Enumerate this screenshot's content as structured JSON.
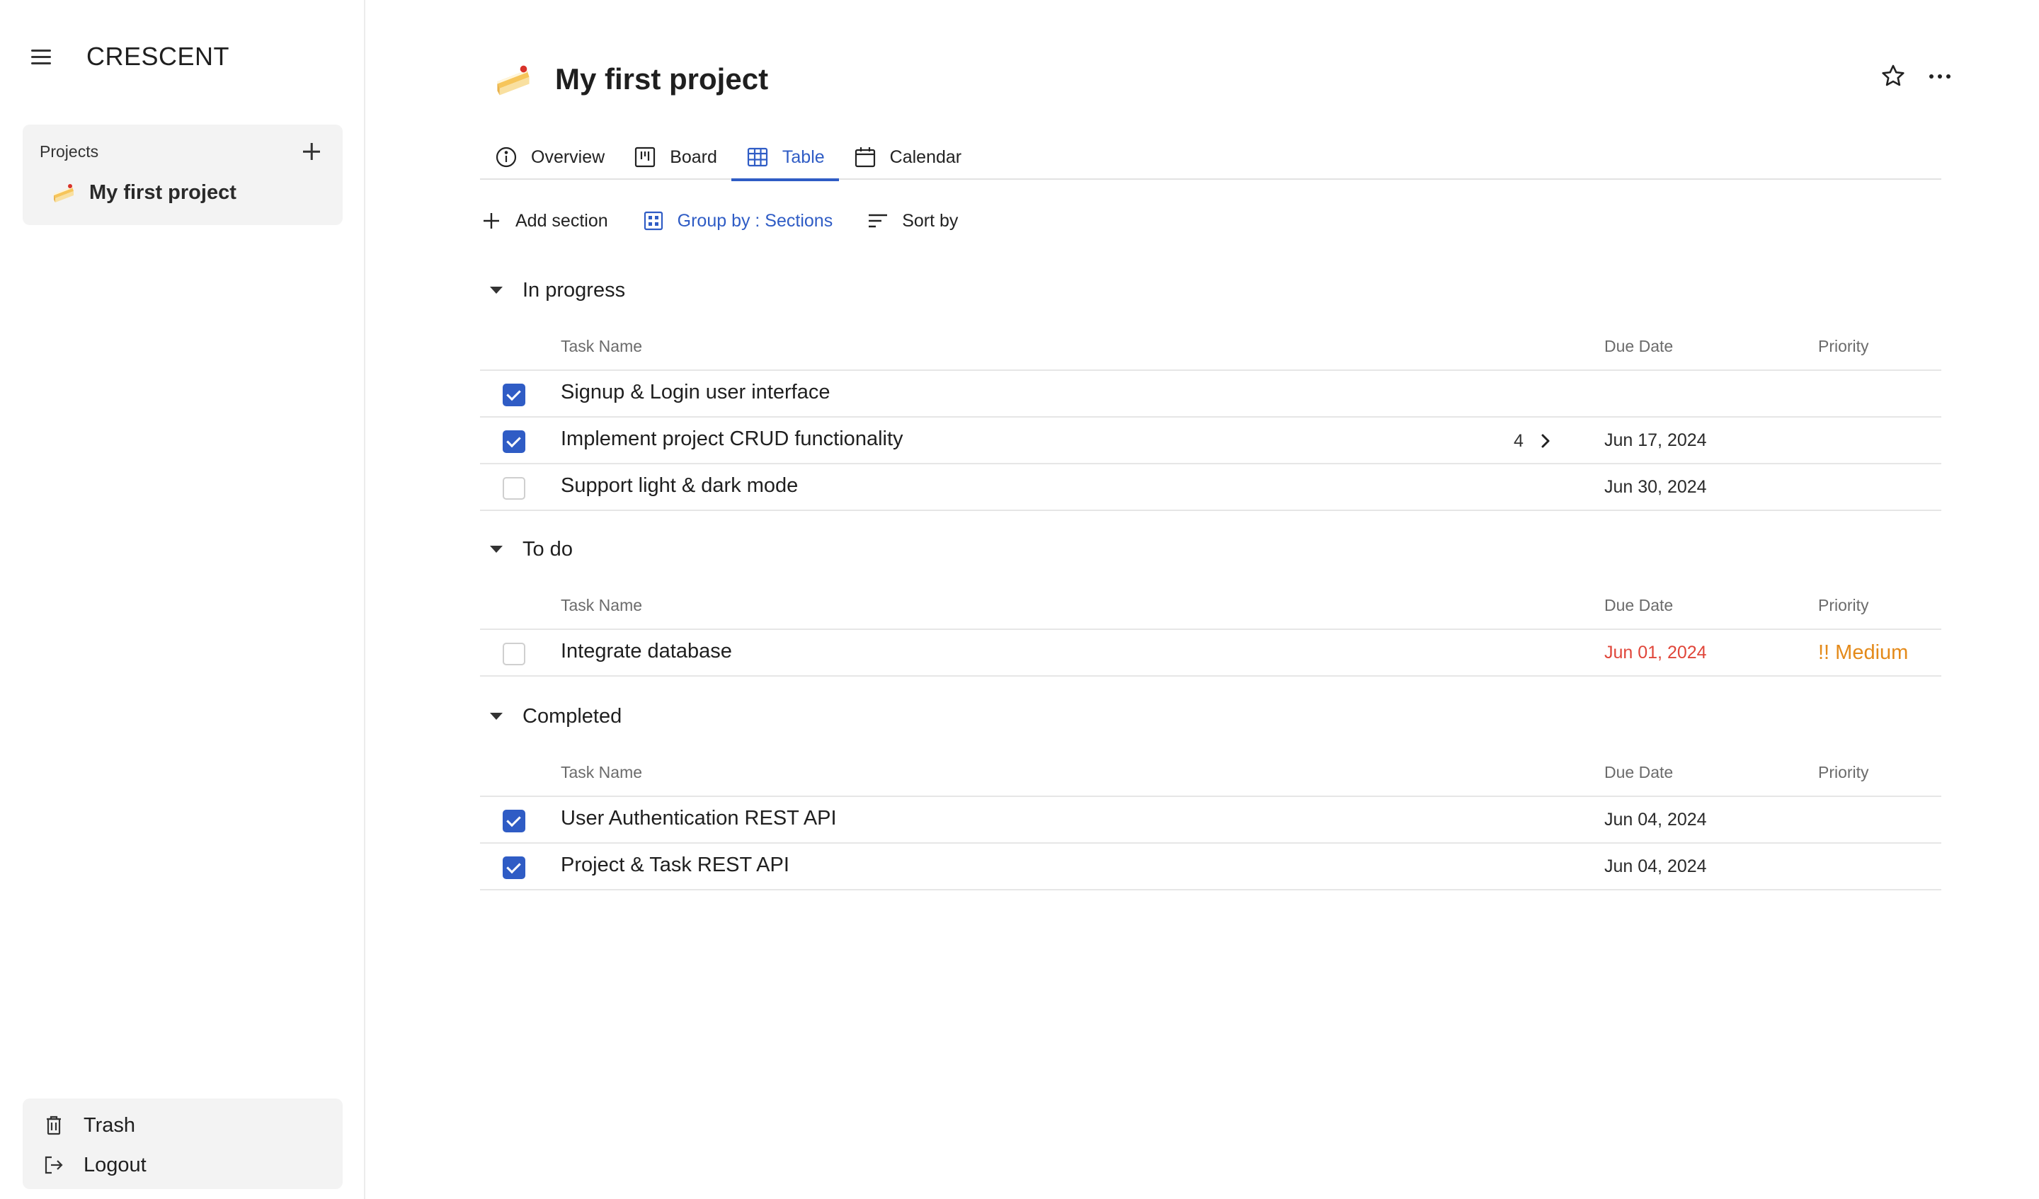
{
  "app": {
    "brand": "CRESCENT"
  },
  "sidebar": {
    "projects_label": "Projects",
    "projects": [
      {
        "name": "My first project",
        "icon": "cake-emoji-icon"
      }
    ],
    "bottom": [
      {
        "label": "Trash",
        "icon": "trash-icon"
      },
      {
        "label": "Logout",
        "icon": "logout-icon"
      }
    ]
  },
  "project": {
    "title": "My first project",
    "icon": "cake-emoji-icon"
  },
  "tabs": [
    {
      "label": "Overview",
      "icon": "info-icon",
      "active": false
    },
    {
      "label": "Board",
      "icon": "board-icon",
      "active": false
    },
    {
      "label": "Table",
      "icon": "table-icon",
      "active": true
    },
    {
      "label": "Calendar",
      "icon": "calendar-icon",
      "active": false
    }
  ],
  "toolbar": {
    "add_section": "Add section",
    "group_by": "Group by : Sections",
    "sort_by": "Sort by"
  },
  "columns": {
    "task_name": "Task Name",
    "due_date": "Due Date",
    "priority": "Priority"
  },
  "sections": [
    {
      "title": "In progress",
      "tasks": [
        {
          "name": "Signup & Login user interface",
          "checked": true,
          "due": "",
          "priority": "",
          "subtasks": ""
        },
        {
          "name": "Implement project CRUD functionality",
          "checked": true,
          "due": "Jun 17, 2024",
          "priority": "",
          "subtasks": "4"
        },
        {
          "name": "Support light & dark mode",
          "checked": false,
          "due": "Jun 30, 2024",
          "priority": "",
          "subtasks": ""
        }
      ]
    },
    {
      "title": "To do",
      "tasks": [
        {
          "name": "Integrate database",
          "checked": false,
          "due": "Jun 01, 2024",
          "due_overdue": true,
          "priority": "!! Medium",
          "subtasks": ""
        }
      ]
    },
    {
      "title": "Completed",
      "tasks": [
        {
          "name": "User Authentication REST API",
          "checked": true,
          "due": "Jun 04, 2024",
          "priority": "",
          "subtasks": ""
        },
        {
          "name": "Project & Task REST API",
          "checked": true,
          "due": "Jun 04, 2024",
          "priority": "",
          "subtasks": ""
        }
      ]
    }
  ],
  "colors": {
    "accent": "#2f5cc5",
    "overdue": "#e0463a",
    "medium_priority": "#e48a1a"
  }
}
